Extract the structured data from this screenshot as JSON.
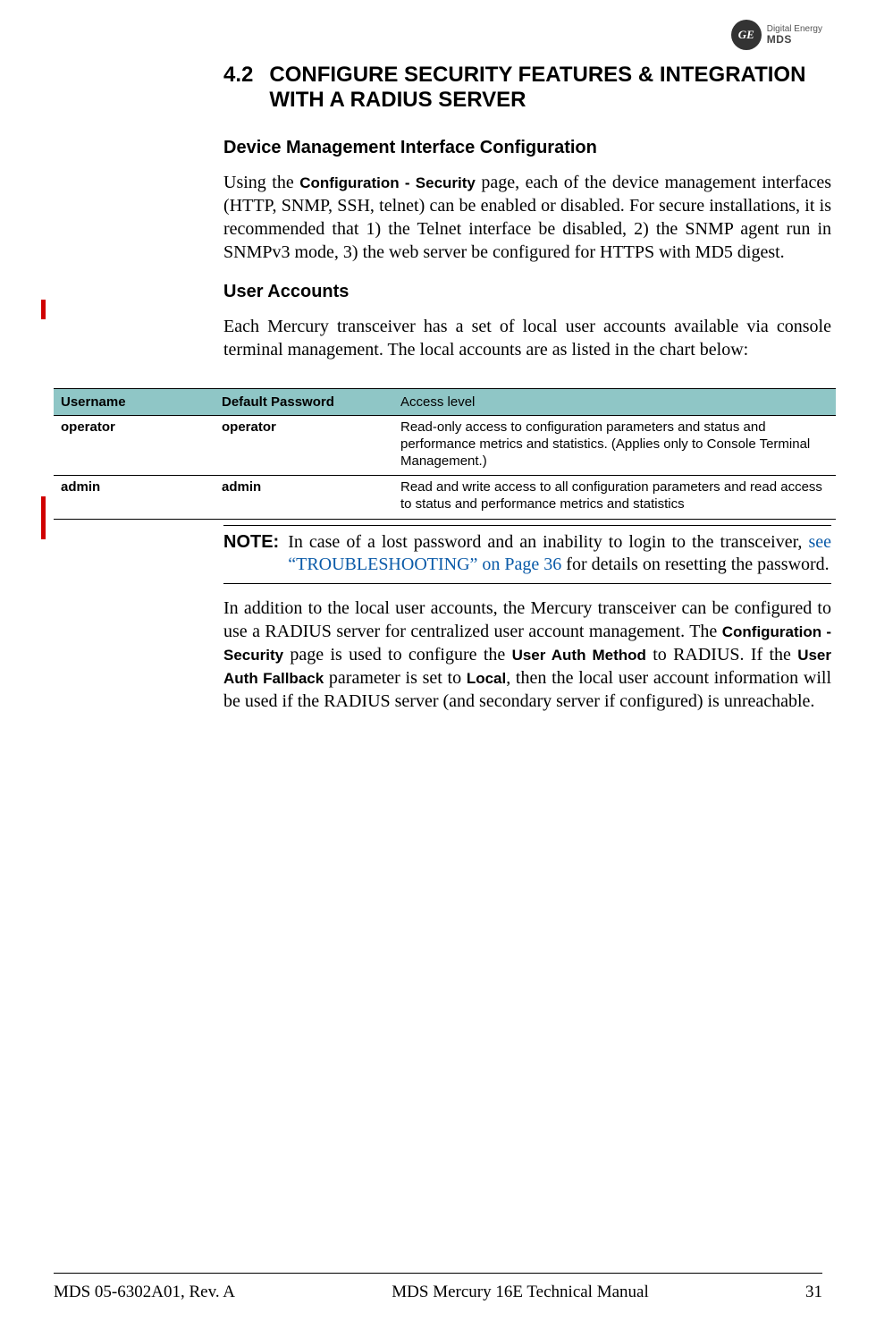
{
  "logo": {
    "monogram": "GE",
    "line1": "Digital Energy",
    "line2": "MDS"
  },
  "section": {
    "number": "4.2",
    "title": "CONFIGURE SECURITY FEATURES & INTEGRATION WITH A RADIUS SERVER"
  },
  "sub1": {
    "heading": "Device Management Interface Configuration",
    "p1_a": "Using the ",
    "p1_bold": "Configuration - Security",
    "p1_b": " page, each of the device management interfaces (HTTP, SNMP, SSH, telnet) can be enabled or disabled. For secure installations, it is recommended that 1) the Telnet interface be disabled, 2) the SNMP agent run in SNMPv3 mode, 3) the web server be configured for HTTPS with MD5 digest."
  },
  "sub2": {
    "heading": "User Accounts",
    "p1": "Each Mercury transceiver has a set of local user accounts available via console terminal management. The local accounts are as listed in the chart below:"
  },
  "table": {
    "headers": [
      "Username",
      "Default Password",
      "Access level"
    ],
    "rows": [
      {
        "c1": "operator",
        "c2": "operator",
        "c3": "Read-only access to configuration parameters and status and performance metrics and statistics. (Applies only to Console Terminal Management.)"
      },
      {
        "c1": "admin",
        "c2": "admin",
        "c3": "Read and write access to all configuration parameters and read access to status and performance metrics and statistics"
      }
    ]
  },
  "note": {
    "label": "NOTE:",
    "a": "In case of a lost password and an inability to login to the transceiver, ",
    "link": "see “TROUBLESHOOTING” on Page  36",
    "b": " for details on resetting the password."
  },
  "p3": {
    "a": "In addition to the local user accounts, the Mercury transceiver can be configured to use a RADIUS server for centralized user account management. The ",
    "b1": "Configuration - Security",
    "c": " page is used to configure the ",
    "b2": "User Auth Method",
    "d": " to RADIUS. If the ",
    "b3": "User Auth Fallback",
    "e": " parameter is set to ",
    "b4": "Local",
    "f": ", then the local user account information will be used if the RADIUS server (and secondary server if configured) is unreachable."
  },
  "footer": {
    "left": "MDS 05-6302A01, Rev.  A",
    "center": "MDS Mercury 16E Technical Manual",
    "right": "31"
  }
}
